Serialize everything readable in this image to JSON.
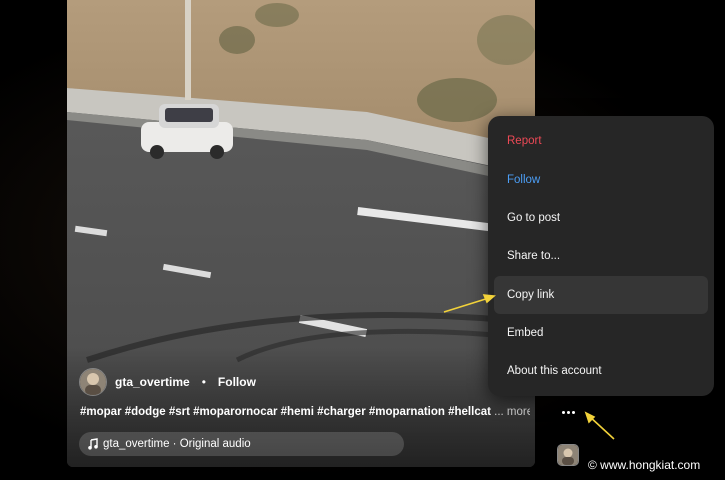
{
  "post": {
    "username": "gta_overtime",
    "separator": "•",
    "follow_label": "Follow",
    "caption": "#mopar #dodge #srt #moparornocar #hemi #charger #moparnation #hellcat",
    "more_label": "... more",
    "audio_label": "gta_overtime · Original audio"
  },
  "menu": {
    "items": [
      {
        "label": "Report"
      },
      {
        "label": "Follow"
      },
      {
        "label": "Go to post"
      },
      {
        "label": "Share to..."
      },
      {
        "label": "Copy link"
      },
      {
        "label": "Embed"
      },
      {
        "label": "About this account"
      }
    ]
  },
  "watermark": "© www.hongkiat.com",
  "colors": {
    "report": "#ed4956",
    "follow": "#4c9ef5",
    "menu_bg": "#262626",
    "arrow": "#f2d23a"
  },
  "icons": {
    "music": "music-note-icon",
    "more": "more-dots-icon"
  }
}
